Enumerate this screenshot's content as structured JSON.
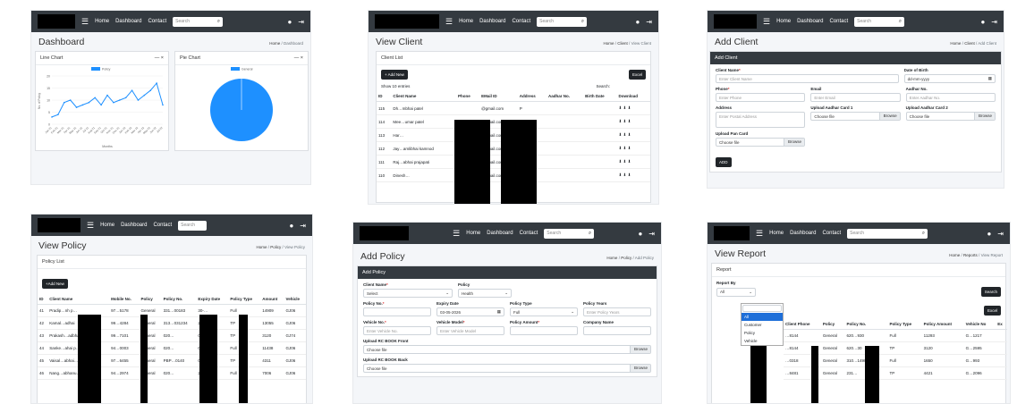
{
  "nav": {
    "home": "Home",
    "dashboard": "Dashboard",
    "contact": "Contact",
    "search_placeholder": "Search"
  },
  "dashboard": {
    "title": "Dashboard",
    "breadcrumb_home": "Home",
    "breadcrumb_current": "Dashboard",
    "line_card_title": "Line Chart",
    "pie_card_title": "Pie Chart",
    "line_y_label": "No. of Policy",
    "line_x_label": "Months",
    "card_controls": "— ×"
  },
  "chart_data": [
    {
      "type": "line",
      "title": "",
      "legend": [
        "Policy"
      ],
      "xlabel": "Months",
      "ylabel": "No. of Policy",
      "ylim": [
        0,
        20
      ],
      "x": [
        "Jan-21",
        "Feb-21",
        "Mar-21",
        "Apr-21",
        "May-21",
        "Jun-21",
        "Jul-21",
        "Aug-21",
        "Sep-21",
        "Oct-21",
        "Nov-21",
        "Dec-21",
        "Jan-22",
        "Feb-22",
        "Mar-22",
        "Apr-22",
        "May-22",
        "Jun-22",
        "Jul-22"
      ],
      "series": [
        {
          "name": "Policy",
          "values": [
            3,
            4,
            9,
            10,
            7,
            8,
            9,
            11,
            8,
            12,
            9,
            10,
            11,
            14,
            10,
            12,
            14,
            17,
            8
          ]
        }
      ]
    },
    {
      "type": "pie",
      "title": "",
      "legend": [
        "General"
      ],
      "labels": [
        "General"
      ],
      "values": [
        100
      ]
    }
  ],
  "view_client": {
    "title": "View Client",
    "breadcrumb": [
      "Home",
      "Client",
      "View Client"
    ],
    "card_title": "Client List",
    "add_label": "+ Add New",
    "excel_label": "Excel",
    "show_label": "Show",
    "show_value": "10",
    "entries_label": "entries",
    "search_label": "Search:",
    "headers": [
      "ID",
      "Client Name",
      "Phone",
      "EMail ID",
      "Address",
      "Aadhar No.",
      "Birth Date",
      "Download"
    ],
    "rows": [
      {
        "id": "115",
        "name": "Dh…mbhai patel",
        "email": "@gmail.com",
        "addr": "P"
      },
      {
        "id": "114",
        "name": "Mee…umar patel",
        "email": "@gmail.com",
        "addr": "P"
      },
      {
        "id": "113",
        "name": "Har…",
        "email": "@gmail.com",
        "addr": "P"
      },
      {
        "id": "112",
        "name": "Jay…amlibhai kamnod",
        "email": "@gmail.com",
        "addr": "P"
      },
      {
        "id": "111",
        "name": "Raj…abhai prajapati",
        "email": "@gmail.com",
        "addr": "P"
      },
      {
        "id": "110",
        "name": "Dinesh…",
        "email": "@gmail.com",
        "addr": "Balapur"
      }
    ],
    "download_icons": "⬇ ⬇ ⬇"
  },
  "add_client": {
    "title": "Add Client",
    "breadcrumb": [
      "Home",
      "Client",
      "Add Client"
    ],
    "card_title": "Add Client",
    "client_name_label": "Client Name",
    "client_name_ph": "Enter Client Name",
    "dob_label": "Date of Birth",
    "dob_ph": "dd-mm-yyyy",
    "phone_label": "Phone",
    "phone_ph": "Enter Phone",
    "email_label": "Email",
    "email_ph": "Enter Email",
    "aadhar_label": "Aadhar No.",
    "aadhar_ph": "Enter Aadhar No.",
    "address_label": "Address",
    "address_ph": "Enter Postal Address",
    "aadhar1_label": "Upload Aadhar Card 1",
    "aadhar2_label": "Upload Aadhar Card 2",
    "pan_label": "Upload Pan Card",
    "choose_file": "Choose file",
    "browse": "Browse",
    "add_btn": "ADD"
  },
  "view_policy": {
    "title": "View Policy",
    "breadcrumb": [
      "Home",
      "Policy",
      "View Policy"
    ],
    "card_title": "Policy List",
    "add_label": "+Add New",
    "headers": [
      "ID",
      "Client Name",
      "Mobile No.",
      "Policy",
      "Policy No.",
      "Expiry Date",
      "Policy Type",
      "Amount",
      "Vehicle"
    ],
    "rows": [
      {
        "id": "41",
        "name": "Pradip…nh p…",
        "mob": "97…5178",
        "pol": "General",
        "pno": "331…00183",
        "exp": "30-…",
        "type": "Full",
        "amt": "14909",
        "veh": "GJ06"
      },
      {
        "id": "42",
        "name": "Kamal…adhai",
        "mob": "99…4284",
        "pol": "General",
        "pno": "313…031234",
        "exp": "26-…",
        "type": "TP",
        "amt": "13055",
        "veh": "GJ06"
      },
      {
        "id": "43",
        "name": "Prakash…adbhai…tbaiya",
        "mob": "99…7101",
        "pol": "General",
        "pno": "020…",
        "exp": "01-…",
        "type": "TP",
        "amt": "3120",
        "veh": "GJ74"
      },
      {
        "id": "44",
        "name": "Sanke…ahai p…",
        "mob": "94…0003",
        "pol": "General",
        "pno": "020…",
        "exp": "06-…",
        "type": "Full",
        "amt": "11438",
        "veh": "GJ06"
      },
      {
        "id": "45",
        "name": "Vaisal…abhai…",
        "mob": "97…6455",
        "pol": "General",
        "pno": "PBP…0140",
        "exp": "01-…",
        "type": "TP",
        "amt": "4311",
        "veh": "GJ06"
      },
      {
        "id": "46",
        "name": "Nang…abhanu…amnaul",
        "mob": "94…2974",
        "pol": "General",
        "pno": "020…",
        "exp": "27-…",
        "type": "Full",
        "amt": "7006",
        "veh": "GJ06"
      }
    ]
  },
  "add_policy": {
    "title": "Add Policy",
    "breadcrumb": [
      "Home",
      "Policy",
      "Add Policy"
    ],
    "card_title": "Add Policy",
    "client_name_label": "Client Name",
    "client_select": "Select",
    "policy_label": "Policy",
    "policy_select": "Health",
    "policy_no_label": "Policy No.",
    "expiry_label": "Expiry Date",
    "expiry_value": "03-05-2026",
    "policy_type_label": "Policy Type",
    "policy_type_value": "Full",
    "policy_years_label": "Policy Years",
    "policy_years_ph": "Enter Policy Years",
    "vehicle_no_label": "Vehicle No.",
    "vehicle_no_ph": "Enter Vehicle No.",
    "vehicle_model_label": "Vehicle Model",
    "vehicle_model_ph": "Enter Vehicle Model",
    "policy_amount_label": "Policy Amount",
    "company_label": "Company Name",
    "rc_front_label": "Upload RC BOOK Front",
    "rc_back_label": "Upload RC BOOK Back",
    "choose_file": "Choose file",
    "browse": "Browse"
  },
  "view_report": {
    "title": "View Report",
    "breadcrumb": [
      "Home",
      "Reports",
      "View Report"
    ],
    "card_title": "Report",
    "report_by_label": "Report By",
    "report_by_value": "All",
    "options": [
      "All",
      "Customer",
      "Policy",
      "Vehicle"
    ],
    "search_btn": "Search",
    "excel_btn": "Excel",
    "headers": [
      "Client Phone",
      "Policy",
      "Policy No.",
      "Policy Type",
      "Policy Amount",
      "Vehicle No",
      "Ex"
    ],
    "rows": [
      {
        "name": "…ali…",
        "ph": "…8144",
        "pol": "General",
        "pno": "620…930",
        "type": "Full",
        "amt": "11293",
        "veh": "G…1217"
      },
      {
        "name": "Am…ulbhai patel",
        "ph": "…8144",
        "pol": "General",
        "pno": "620…30",
        "type": "TP",
        "amt": "3120",
        "veh": "G…2595"
      },
      {
        "name": "Am…dabhai desai",
        "ph": "…0318",
        "pol": "General",
        "pno": "310…14980504",
        "type": "Full",
        "amt": "1650",
        "veh": "G…993"
      },
      {
        "name": "A…r…sahala",
        "ph": "…8481",
        "pol": "General",
        "pno": "231…",
        "type": "TP",
        "amt": "4421",
        "veh": "G…2096"
      }
    ]
  }
}
